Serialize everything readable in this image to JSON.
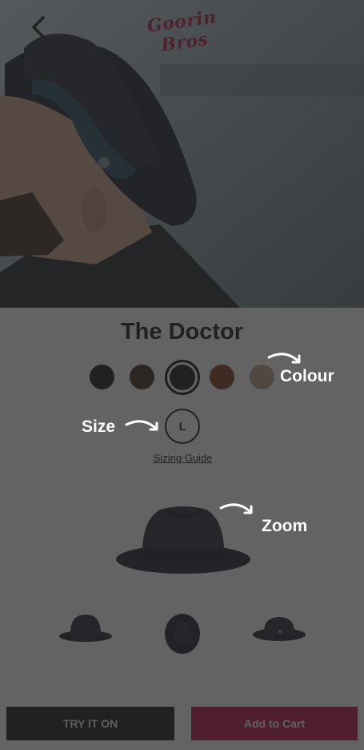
{
  "header": {
    "brand": "Goorin Bros",
    "back_icon": "chevron-left-icon"
  },
  "product": {
    "title": "The Doctor",
    "size": "L",
    "sizing_guide": "Sizing Guide"
  },
  "swatches": [
    {
      "color": "#0f0f10"
    },
    {
      "color": "#3a2519"
    },
    {
      "color": "#111114",
      "selected": true
    },
    {
      "color": "#7a3412"
    },
    {
      "color": "#b9997a"
    }
  ],
  "actions": {
    "try_on": "TRY IT ON",
    "add_to_cart": "Add to Cart"
  },
  "hints": {
    "colour": "Colour",
    "size": "Size",
    "zoom": "Zoom"
  },
  "colors": {
    "overlay": "rgba(40,40,40,0.72)",
    "accent": "#b70a3c",
    "text": "#111111"
  }
}
